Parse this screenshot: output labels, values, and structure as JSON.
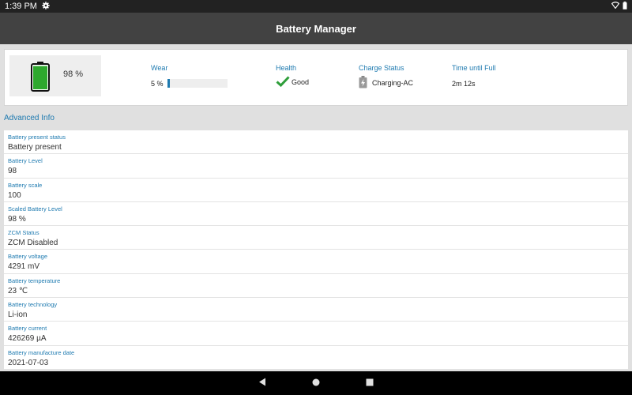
{
  "status_bar": {
    "time": "1:39 PM"
  },
  "app_bar": {
    "title": "Battery Manager"
  },
  "summary": {
    "battery_percent": "98 %",
    "battery_level_fraction": 0.98,
    "wear": {
      "title": "Wear",
      "value": "5 %",
      "fraction": 0.05
    },
    "health": {
      "title": "Health",
      "value": "Good"
    },
    "charge_status": {
      "title": "Charge Status",
      "value": "Charging-AC"
    },
    "time_until_full": {
      "title": "Time until Full",
      "value": "2m 12s"
    }
  },
  "advanced": {
    "title": "Advanced Info",
    "items": [
      {
        "label": "Battery present status",
        "value": "Battery present"
      },
      {
        "label": "Battery Level",
        "value": "98"
      },
      {
        "label": "Battery scale",
        "value": "100"
      },
      {
        "label": "Scaled Battery Level",
        "value": "98 %"
      },
      {
        "label": "ZCM Status",
        "value": "ZCM Disabled"
      },
      {
        "label": "Battery voltage",
        "value": "4291 mV"
      },
      {
        "label": "Battery temperature",
        "value": "23 ℃"
      },
      {
        "label": "Battery technology",
        "value": "Li-ion"
      },
      {
        "label": "Battery current",
        "value": "426269 µA"
      },
      {
        "label": "Battery manufacture date",
        "value": "2021-07-03"
      }
    ]
  },
  "colors": {
    "accent": "#1e7ab0",
    "battery_green": "#2ea82e",
    "check_green": "#2e9e3a"
  },
  "icons": [
    "settings-gear-icon",
    "wifi-icon",
    "battery-status-icon",
    "battery-icon",
    "check-icon",
    "charging-plug-icon",
    "back-icon",
    "home-icon",
    "recents-icon"
  ]
}
